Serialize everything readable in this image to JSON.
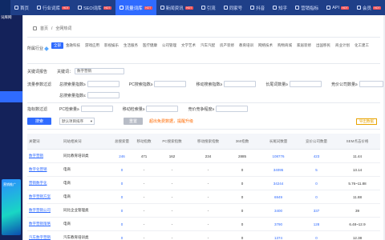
{
  "nav": {
    "items": [
      {
        "label": "首页",
        "hot": false
      },
      {
        "label": "行业词库",
        "hot": true
      },
      {
        "label": "SEO词库",
        "hot": true
      },
      {
        "label": "流量词库",
        "hot": true,
        "active": true
      },
      {
        "label": "新闻资讯",
        "hot": true
      },
      {
        "label": "引流",
        "hot": false
      },
      {
        "label": "同家号",
        "hot": false
      },
      {
        "label": "抖音",
        "hot": false
      },
      {
        "label": "知乎",
        "hot": false
      },
      {
        "label": "营销指标",
        "hot": false
      },
      {
        "label": "API",
        "hot": true
      },
      {
        "label": "会员",
        "hot": true
      }
    ],
    "hot_label": "HOT"
  },
  "sidebar": {
    "logo_text": "词库网",
    "promo_text": "营销推广"
  },
  "breadcrumb": {
    "home": "首页",
    "sep": "/",
    "current": "全网热词"
  },
  "industry": {
    "label": "所属行业",
    "chips": [
      "全部",
      "金融科技",
      "游戏应用",
      "影视娱乐",
      "生活服务",
      "医疗健康",
      "公司管理",
      "文学艺术",
      "汽车汽配",
      "房产装修",
      "教育培训",
      "网络技术",
      "购物商城",
      "家居装修",
      "出国移民",
      "商业计划",
      "化工建工"
    ]
  },
  "keyword": {
    "label": "关键词报告",
    "field_label": "关键词：",
    "value": "数字营销"
  },
  "filters": {
    "row1_label": "流量参数过滤",
    "row1": [
      "总搜索量指数≥",
      "PC搜索指数≥",
      "移动搜索指数≥",
      "长尾词数量≥",
      "竞价公司数量≥"
    ],
    "row1b": "总搜索量指数≤",
    "row2_label": "指标数过滤",
    "row2": [
      "PC检索量≥",
      "移动检索量≥",
      "竞价竞争程度≥"
    ]
  },
  "actions": {
    "search": "搜索",
    "sort_placeholder": "默认项目排序",
    "reset": "重置",
    "warn": "超出免费数据，提醒升级",
    "export": "导出数据"
  },
  "table": {
    "headers": [
      "关键词",
      "同站相关词",
      "总搜索量",
      "移动指数",
      "PC搜索指数",
      "移动搜索指数",
      "360指数",
      "长尾词数量",
      "竞价公司数量",
      "SEM点击价格"
    ],
    "rows": [
      {
        "kw": "数字营销",
        "related": "同比教育培训类",
        "total": "246",
        "mobile": "471",
        "pc": "162",
        "mob_idx": "234",
        "i360": "2885",
        "long": "108776",
        "bid": "423",
        "sem": "11.44",
        "up": true
      },
      {
        "kw": "数字化营销",
        "related": "电商",
        "total": "0",
        "mobile": "-",
        "pc": "-",
        "mob_idx": "-",
        "i360": "0",
        "long": "34095",
        "bid": "5",
        "sem": "13.14",
        "up": false
      },
      {
        "kw": "营销数字化",
        "related": "电商",
        "total": "0",
        "mobile": "-",
        "pc": "-",
        "mob_idx": "-",
        "i360": "0",
        "long": "34244",
        "bid": "0",
        "sem": "5.76~11.88",
        "up": false
      },
      {
        "kw": "数字营销方案",
        "related": "电商",
        "total": "0",
        "mobile": "-",
        "pc": "-",
        "mob_idx": "-",
        "i360": "0",
        "long": "6949",
        "bid": "0",
        "sem": "11.88",
        "up": false
      },
      {
        "kw": "数字营销公司",
        "related": "同比企业管理类",
        "total": "0",
        "mobile": "-",
        "pc": "-",
        "mob_idx": "-",
        "i360": "0",
        "long": "3400",
        "bid": "337",
        "sem": "39",
        "up": false
      },
      {
        "kw": "数字营销策略",
        "related": "电商",
        "total": "0",
        "mobile": "-",
        "pc": "-",
        "mob_idx": "-",
        "i360": "0",
        "long": "3790",
        "bid": "128",
        "sem": "6.48~12.9",
        "up": false
      },
      {
        "kw": "汽车数字营销",
        "related": "汽车教育培训类",
        "total": "0",
        "mobile": "-",
        "pc": "-",
        "mob_idx": "-",
        "i360": "0",
        "long": "1374",
        "bid": "0",
        "sem": "12.38",
        "up": false
      }
    ]
  }
}
